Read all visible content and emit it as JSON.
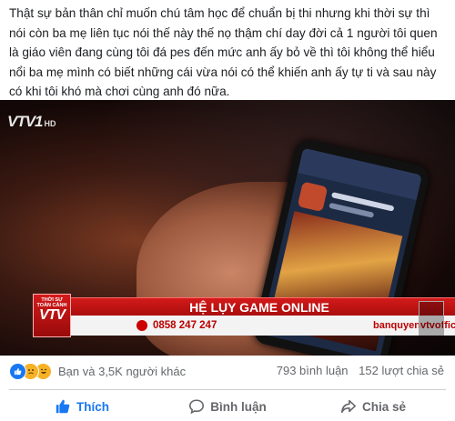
{
  "post": {
    "text": "Thật sự bản thân chỉ muốn chú tâm học để chuẩn bị thi nhưng khi thời sự thì nói còn ba mẹ liên tục nói thế này thế nọ thậm chí day đời cả 1 người tôi quen là giáo viên đang cùng tôi đá pes đến mức anh ấy bỏ về thì tôi không thể hiểu nổi ba mẹ mình có biết những cái vừa nói có thể khiến anh ấy tự ti và sau này có khi tôi khó mà chơi cùng anh đó nữa."
  },
  "video": {
    "channel_logo": "VTV1",
    "hd": "HD",
    "box_small": "THỜI SỰ TOÀN CẢNH",
    "box_mark": "VTV",
    "headline": "HỆ LỤY GAME ONLINE",
    "hotline": "0858 247 247",
    "email": "banquyenvtvofficial@gmail.com"
  },
  "engagement": {
    "reactions_text": "Bạn và 3,5K người khác",
    "comments": "793 bình luận",
    "shares": "152 lượt chia sẻ"
  },
  "actions": {
    "like": "Thích",
    "comment": "Bình luận",
    "share": "Chia sẻ"
  },
  "colors": {
    "accent": "#1877f2",
    "muted": "#65676b",
    "vtv_red": "#d41a1a"
  }
}
